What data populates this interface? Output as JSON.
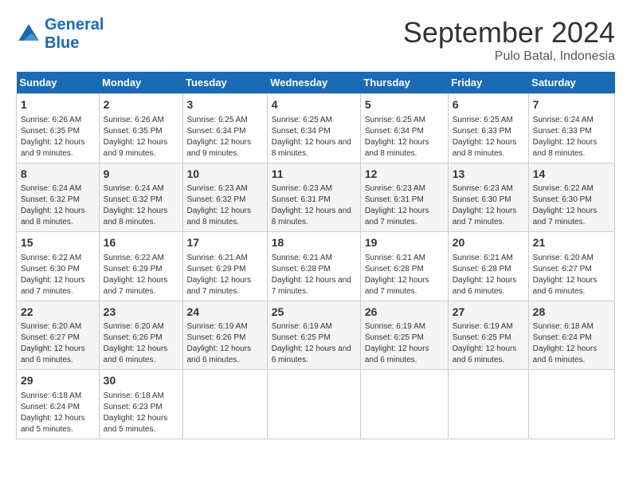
{
  "header": {
    "logo_line1": "General",
    "logo_line2": "Blue",
    "month_title": "September 2024",
    "location": "Pulo Batal, Indonesia"
  },
  "weekdays": [
    "Sunday",
    "Monday",
    "Tuesday",
    "Wednesday",
    "Thursday",
    "Friday",
    "Saturday"
  ],
  "weeks": [
    [
      {
        "day": "1",
        "sunrise": "6:26 AM",
        "sunset": "6:35 PM",
        "daylight": "12 hours and 9 minutes."
      },
      {
        "day": "2",
        "sunrise": "6:26 AM",
        "sunset": "6:35 PM",
        "daylight": "12 hours and 9 minutes."
      },
      {
        "day": "3",
        "sunrise": "6:25 AM",
        "sunset": "6:34 PM",
        "daylight": "12 hours and 9 minutes."
      },
      {
        "day": "4",
        "sunrise": "6:25 AM",
        "sunset": "6:34 PM",
        "daylight": "12 hours and 8 minutes."
      },
      {
        "day": "5",
        "sunrise": "6:25 AM",
        "sunset": "6:34 PM",
        "daylight": "12 hours and 8 minutes."
      },
      {
        "day": "6",
        "sunrise": "6:25 AM",
        "sunset": "6:33 PM",
        "daylight": "12 hours and 8 minutes."
      },
      {
        "day": "7",
        "sunrise": "6:24 AM",
        "sunset": "6:33 PM",
        "daylight": "12 hours and 8 minutes."
      }
    ],
    [
      {
        "day": "8",
        "sunrise": "6:24 AM",
        "sunset": "6:32 PM",
        "daylight": "12 hours and 8 minutes."
      },
      {
        "day": "9",
        "sunrise": "6:24 AM",
        "sunset": "6:32 PM",
        "daylight": "12 hours and 8 minutes."
      },
      {
        "day": "10",
        "sunrise": "6:23 AM",
        "sunset": "6:32 PM",
        "daylight": "12 hours and 8 minutes."
      },
      {
        "day": "11",
        "sunrise": "6:23 AM",
        "sunset": "6:31 PM",
        "daylight": "12 hours and 8 minutes."
      },
      {
        "day": "12",
        "sunrise": "6:23 AM",
        "sunset": "6:31 PM",
        "daylight": "12 hours and 7 minutes."
      },
      {
        "day": "13",
        "sunrise": "6:23 AM",
        "sunset": "6:30 PM",
        "daylight": "12 hours and 7 minutes."
      },
      {
        "day": "14",
        "sunrise": "6:22 AM",
        "sunset": "6:30 PM",
        "daylight": "12 hours and 7 minutes."
      }
    ],
    [
      {
        "day": "15",
        "sunrise": "6:22 AM",
        "sunset": "6:30 PM",
        "daylight": "12 hours and 7 minutes."
      },
      {
        "day": "16",
        "sunrise": "6:22 AM",
        "sunset": "6:29 PM",
        "daylight": "12 hours and 7 minutes."
      },
      {
        "day": "17",
        "sunrise": "6:21 AM",
        "sunset": "6:29 PM",
        "daylight": "12 hours and 7 minutes."
      },
      {
        "day": "18",
        "sunrise": "6:21 AM",
        "sunset": "6:28 PM",
        "daylight": "12 hours and 7 minutes."
      },
      {
        "day": "19",
        "sunrise": "6:21 AM",
        "sunset": "6:28 PM",
        "daylight": "12 hours and 7 minutes."
      },
      {
        "day": "20",
        "sunrise": "6:21 AM",
        "sunset": "6:28 PM",
        "daylight": "12 hours and 6 minutes."
      },
      {
        "day": "21",
        "sunrise": "6:20 AM",
        "sunset": "6:27 PM",
        "daylight": "12 hours and 6 minutes."
      }
    ],
    [
      {
        "day": "22",
        "sunrise": "6:20 AM",
        "sunset": "6:27 PM",
        "daylight": "12 hours and 6 minutes."
      },
      {
        "day": "23",
        "sunrise": "6:20 AM",
        "sunset": "6:26 PM",
        "daylight": "12 hours and 6 minutes."
      },
      {
        "day": "24",
        "sunrise": "6:19 AM",
        "sunset": "6:26 PM",
        "daylight": "12 hours and 6 minutes."
      },
      {
        "day": "25",
        "sunrise": "6:19 AM",
        "sunset": "6:25 PM",
        "daylight": "12 hours and 6 minutes."
      },
      {
        "day": "26",
        "sunrise": "6:19 AM",
        "sunset": "6:25 PM",
        "daylight": "12 hours and 6 minutes."
      },
      {
        "day": "27",
        "sunrise": "6:19 AM",
        "sunset": "6:25 PM",
        "daylight": "12 hours and 6 minutes."
      },
      {
        "day": "28",
        "sunrise": "6:18 AM",
        "sunset": "6:24 PM",
        "daylight": "12 hours and 6 minutes."
      }
    ],
    [
      {
        "day": "29",
        "sunrise": "6:18 AM",
        "sunset": "6:24 PM",
        "daylight": "12 hours and 5 minutes."
      },
      {
        "day": "30",
        "sunrise": "6:18 AM",
        "sunset": "6:23 PM",
        "daylight": "12 hours and 5 minutes."
      },
      null,
      null,
      null,
      null,
      null
    ]
  ]
}
